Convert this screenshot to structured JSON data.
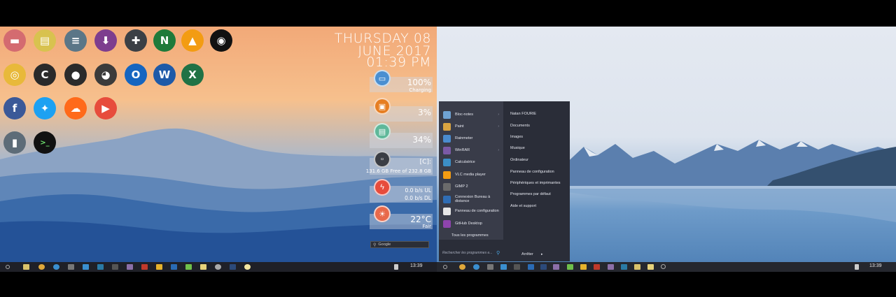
{
  "left_screen": {
    "desktop_icons": [
      {
        "name": "folder-icon",
        "color": "#d46b70",
        "glyph": "▬"
      },
      {
        "name": "file-icon",
        "color": "#d8c24f",
        "glyph": "▤"
      },
      {
        "name": "storage-icon",
        "color": "#5b7687",
        "glyph": "≡"
      },
      {
        "name": "download-icon",
        "color": "#7d3d8e",
        "glyph": "⬇"
      },
      {
        "name": "calculator-icon",
        "color": "#3b3f45",
        "glyph": "✚"
      },
      {
        "name": "notepadpp-icon",
        "color": "#1f7a3a",
        "glyph": "N"
      },
      {
        "name": "vlc-icon",
        "color": "#f39c12",
        "glyph": "▲"
      },
      {
        "name": "obs-icon",
        "color": "#111111",
        "glyph": "◉"
      },
      {
        "name": "chrome-icon",
        "color": "#e8b93a",
        "glyph": "◎"
      },
      {
        "name": "ccleaner-icon",
        "color": "#2a2a2a",
        "glyph": "C"
      },
      {
        "name": "github-icon",
        "color": "#2b2b2b",
        "glyph": "●"
      },
      {
        "name": "gimp-icon",
        "color": "#3b3b3b",
        "glyph": "◕"
      },
      {
        "name": "outlook-icon",
        "color": "#1565c0",
        "glyph": "O"
      },
      {
        "name": "word-icon",
        "color": "#1e5aa8",
        "glyph": "W"
      },
      {
        "name": "excel-icon",
        "color": "#207245",
        "glyph": "X"
      },
      {
        "name": "facebook-icon",
        "color": "#3b5998",
        "glyph": "f"
      },
      {
        "name": "twitter-icon",
        "color": "#1da1f2",
        "glyph": "✦"
      },
      {
        "name": "soundcloud-icon",
        "color": "#ff6a1a",
        "glyph": "☁"
      },
      {
        "name": "youtube-icon",
        "color": "#e74c3c",
        "glyph": "▶"
      },
      {
        "name": "recycle-bin-icon",
        "color": "#5d6c78",
        "glyph": "▮"
      },
      {
        "name": "terminal-icon",
        "color": "#111111",
        "glyph": ">_"
      }
    ],
    "clock": {
      "line1": "THURSDAY 08",
      "line2": "JUNE 2017",
      "line3": "01:39 PM"
    },
    "widgets": {
      "battery": {
        "value": "100%",
        "sub": "Charging"
      },
      "cpu": {
        "value": "3%"
      },
      "ram": {
        "value": "34%"
      },
      "disk": {
        "label": "[C]:",
        "sub": "131.6 GB Free of 232.8 GB"
      },
      "network": {
        "ul": "0.0 b/s  UL",
        "dl": "0.0 b/s  DL"
      },
      "weather": {
        "temp": "22°C",
        "cond": "Fair"
      }
    },
    "search": {
      "placeholder": "Google"
    },
    "taskbar": {
      "time": "13:39"
    }
  },
  "right_screen": {
    "start_menu": {
      "programs": [
        {
          "label": "Bloc-notes",
          "color": "#6fa3d4",
          "arrow": true
        },
        {
          "label": "Paint",
          "color": "#d9a441",
          "arrow": true
        },
        {
          "label": "Rainmeter",
          "color": "#4a8ccf",
          "arrow": false
        },
        {
          "label": "WinRAR",
          "color": "#7b5aa6",
          "arrow": true
        },
        {
          "label": "Calculatrice",
          "color": "#3c8fc7",
          "arrow": false
        },
        {
          "label": "VLC media player",
          "color": "#f39c12",
          "arrow": false
        },
        {
          "label": "GIMP 2",
          "color": "#6b6b6b",
          "arrow": false
        },
        {
          "label": "Connexion Bureau à distance",
          "color": "#2f6db5",
          "arrow": false
        },
        {
          "label": "Panneau de configuration",
          "color": "#e6e6e6",
          "arrow": true
        },
        {
          "label": "GitHub Desktop",
          "color": "#8e44ad",
          "arrow": false
        }
      ],
      "all_programs": "Tous les programmes",
      "right_items": [
        "Natan FOURIE",
        "Documents",
        "Images",
        "Musique",
        "Ordinateur",
        "Panneau de configuration",
        "Périphériques et imprimantes",
        "Programmes par défaut",
        "Aide et support"
      ],
      "search_placeholder": "Rechercher les programmes e...",
      "shutdown_label": "Arrêter"
    },
    "taskbar": {
      "time": "13:39"
    }
  }
}
